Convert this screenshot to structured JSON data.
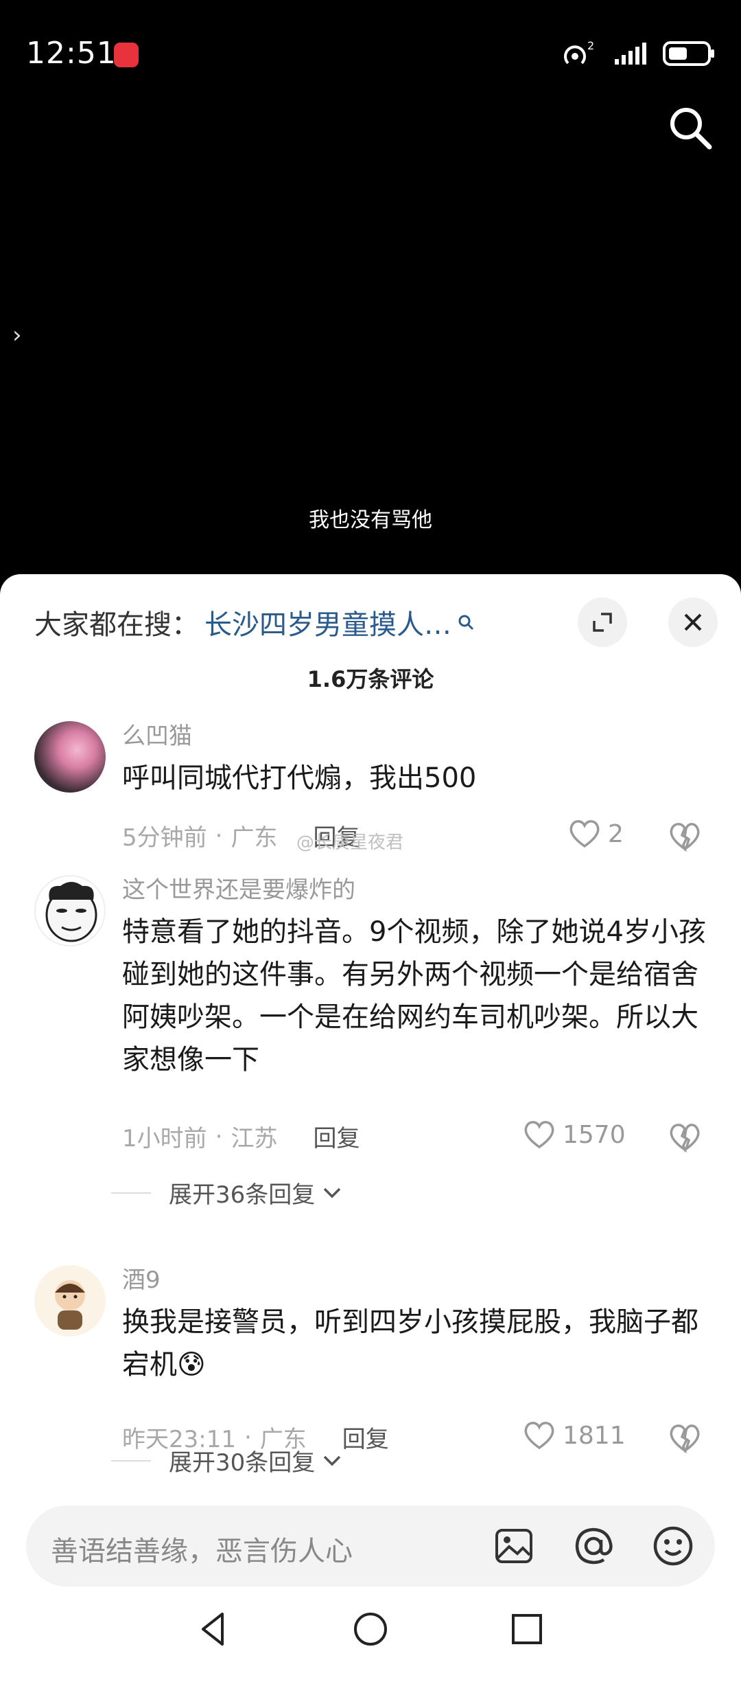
{
  "status": {
    "time": "12:51",
    "signal_sup": "2"
  },
  "video": {
    "subtitle": "我也没有骂他"
  },
  "sheet": {
    "hot_search_label": "大家都在搜：",
    "hot_search_query": "长沙四岁男童摸人…",
    "comment_count": "1.6万条评论",
    "watermark": "@长庚星夜君"
  },
  "comments": [
    {
      "username": "么凹猫",
      "text": "呼叫同城代打代煽，我出500",
      "time": "5分钟前",
      "location": "广东",
      "reply_label": "回复",
      "likes": "2"
    },
    {
      "username": "这个世界还是要爆炸的",
      "text": "特意看了她的抖音。9个视频，除了她说4岁小孩碰到她的这件事。有另外两个视频一个是给宿舍阿姨吵架。一个是在给网约车司机吵架。所以大家想像一下",
      "time": "1小时前",
      "location": "江苏",
      "reply_label": "回复",
      "likes": "1570",
      "expand_label": "展开36条回复"
    },
    {
      "username": "酒9",
      "text": "换我是接警员，听到四岁小孩摸屁股，我脑子都宕机😰",
      "time": "昨天23:11",
      "location": "广东",
      "reply_label": "回复",
      "likes": "1811",
      "expand_label": "展开30条回复"
    }
  ],
  "input": {
    "placeholder": "善语结善缘，恶言伤人心"
  }
}
